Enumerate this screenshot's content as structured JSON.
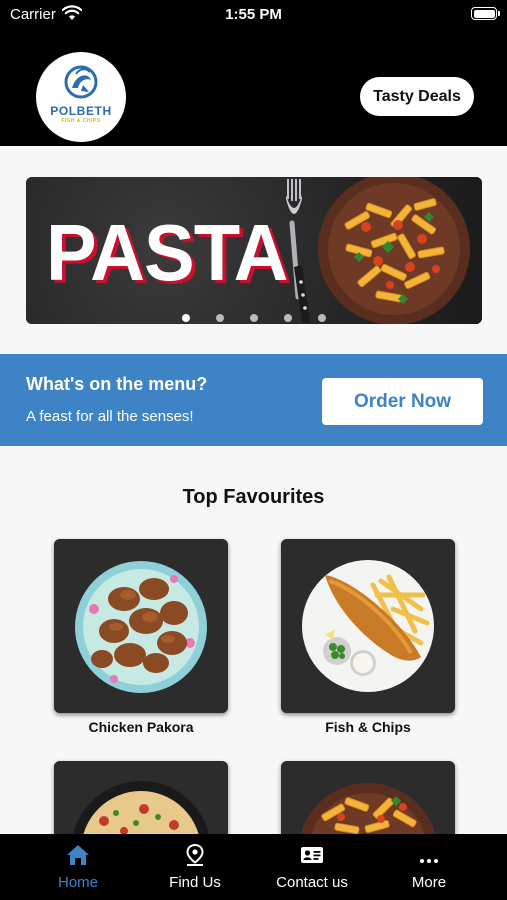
{
  "status_bar": {
    "carrier": "Carrier",
    "time": "1:55 PM"
  },
  "header": {
    "logo_title": "POLBETH",
    "logo_subtitle": "FISH & CHIPS",
    "deals_button": "Tasty Deals"
  },
  "banner": {
    "headline": "PASTA",
    "slide_count": 5,
    "active_slide": 0
  },
  "cta": {
    "title": "What's on the menu?",
    "subtitle": "A feast for all the senses!",
    "button": "Order Now",
    "color": "#3d83c6"
  },
  "favourites": {
    "title": "Top Favourites",
    "items": [
      {
        "label": "Chicken Pakora"
      },
      {
        "label": "Fish & Chips"
      },
      {
        "label": ""
      },
      {
        "label": ""
      }
    ]
  },
  "tabs": [
    {
      "label": "Home",
      "icon": "home-icon",
      "active": true
    },
    {
      "label": "Find Us",
      "icon": "location-pin-icon",
      "active": false
    },
    {
      "label": "Contact us",
      "icon": "contact-card-icon",
      "active": false
    },
    {
      "label": "More",
      "icon": "more-dots-icon",
      "active": false
    }
  ],
  "colors": {
    "accent": "#3d83c6",
    "header_bg": "#000000",
    "tabbar_bg": "#000000"
  }
}
